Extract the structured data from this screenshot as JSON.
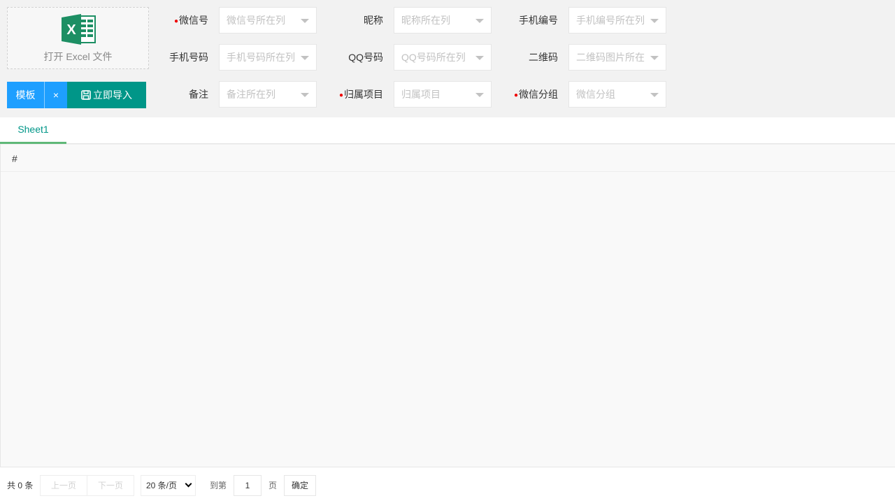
{
  "upload": {
    "label": "打开 Excel 文件",
    "icon": "excel-icon"
  },
  "buttons": {
    "template": "模板",
    "clear": "×",
    "import": "立即导入"
  },
  "fields": [
    {
      "label": "微信号",
      "required": true,
      "placeholder": "微信号所在列"
    },
    {
      "label": "昵称",
      "required": false,
      "placeholder": "昵称所在列"
    },
    {
      "label": "手机编号",
      "required": false,
      "placeholder": "手机编号所在列"
    },
    {
      "label": "手机号码",
      "required": false,
      "placeholder": "手机号码所在列"
    },
    {
      "label": "QQ号码",
      "required": false,
      "placeholder": "QQ号码所在列"
    },
    {
      "label": "二维码",
      "required": false,
      "placeholder": "二维码图片所在"
    },
    {
      "label": "备注",
      "required": false,
      "placeholder": "备注所在列"
    },
    {
      "label": "归属项目",
      "required": true,
      "placeholder": "归属项目"
    },
    {
      "label": "微信分组",
      "required": true,
      "placeholder": "微信分组"
    }
  ],
  "required_mark": "●",
  "tabs": [
    {
      "label": "Sheet1"
    }
  ],
  "table": {
    "header": "#"
  },
  "pager": {
    "total": "共 0 条",
    "prev": "上一页",
    "next": "下一页",
    "page_size": "20 条/页",
    "goto_prefix": "到第",
    "page": "1",
    "goto_suffix": "页",
    "confirm": "确定"
  },
  "colors": {
    "primary": "#1e9fff",
    "accent": "#009688",
    "tab_underline": "#5fb878",
    "required": "#e00000"
  }
}
